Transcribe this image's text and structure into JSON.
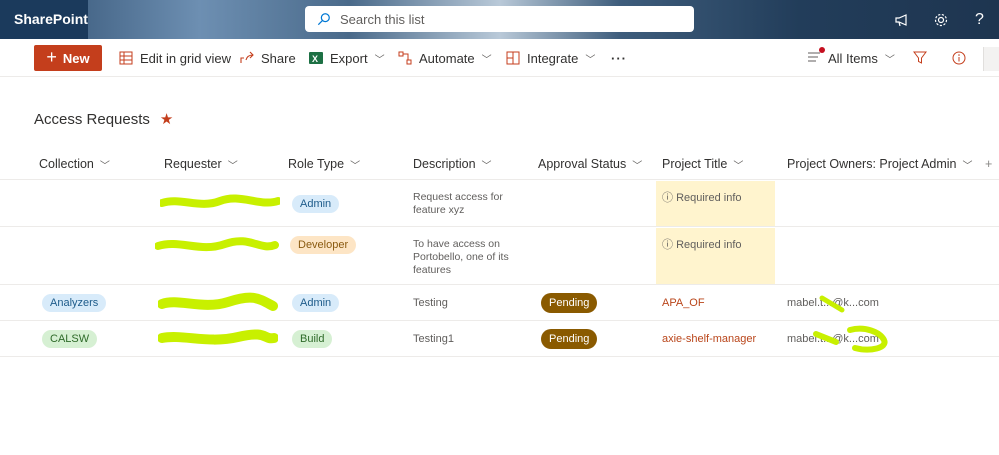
{
  "app": {
    "brand": "SharePoint"
  },
  "search": {
    "placeholder": "Search this list"
  },
  "topicons": [
    "megaphone-icon",
    "gear-icon",
    "help-icon"
  ],
  "toolbar": {
    "new_label": "New",
    "edit_grid": "Edit in grid view",
    "share": "Share",
    "export": "Export",
    "automate": "Automate",
    "integrate": "Integrate",
    "more": "···",
    "view": "All Items"
  },
  "page": {
    "title": "Access Requests"
  },
  "columns": {
    "collection": "Collection",
    "requester": "Requester",
    "role": "Role Type",
    "description": "Description",
    "status": "Approval Status",
    "project": "Project Title",
    "owners": "Project Owners: Project Admin",
    "add": "+"
  },
  "rows": [
    {
      "collection": "",
      "role": "Admin",
      "description": "Request access for feature xyz",
      "status": "",
      "project": "Required info",
      "owner": ""
    },
    {
      "collection": "",
      "role": "Developer",
      "description": "To have access on Portobello, one of its features",
      "status": "",
      "project": "Required info",
      "owner": ""
    },
    {
      "collection": "Analyzers",
      "role": "Admin",
      "description": "Testing",
      "status": "Pending",
      "project": "APA_OF",
      "owner": "mabel.t...@k...com"
    },
    {
      "collection": "CALSW",
      "role": "Build",
      "description": "Testing1",
      "status": "Pending",
      "project": "axie-shelf-manager",
      "owner": "mabel.t...@k...com"
    }
  ],
  "colors": {
    "accent": "#c43e1c",
    "pending": "#8a5a00",
    "required_bg": "#fff4ce",
    "redaction": "#c8f000"
  }
}
